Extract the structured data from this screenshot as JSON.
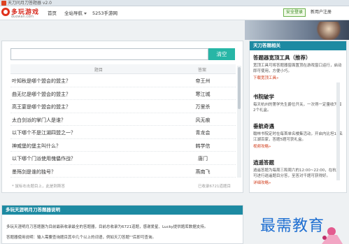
{
  "window": {
    "title": "天刀问月刀答题器 v2.0"
  },
  "nav": {
    "logo_brand": "多玩游戏",
    "logo_domain": "duowan.com",
    "home": "首页",
    "all_nav": "全站导航",
    "mobile": "5253手游网",
    "safe_login": "安全登录",
    "new_user": "新用户注册"
  },
  "search": {
    "button": "清空",
    "placeholder": ""
  },
  "table": {
    "col_question": "题目",
    "col_answer": "答案",
    "rows": [
      {
        "q": "叶知秋是哪个盟会的盟主？",
        "a": "帝王州"
      },
      {
        "q": "曲无忆是哪个盟会的盟主？",
        "a": "寒江城"
      },
      {
        "q": "高王宴是哪个盟会的盟主？",
        "a": "万里杀"
      },
      {
        "q": "太白剑派的掌门人是谁？",
        "a": "风无痕"
      },
      {
        "q": "以下哪个不是江湖四盟之一？",
        "a": "青龙会"
      },
      {
        "q": "神威堡的堡主叫什么？",
        "a": "韩学信"
      },
      {
        "q": "以下哪个门派使用傀儡作战？",
        "a": "唐门"
      },
      {
        "q": "墨殇剑是谁的独号？",
        "a": "燕南飞"
      }
    ],
    "footnote": "* 鼠标右击题目上，此是刺斯答",
    "count": "已收录6721道题目"
  },
  "sidebar": {
    "header": "天刀答题相关",
    "sections": [
      {
        "title": "答题器宽顶工具（推荐）",
        "desc": "宽顶工具可将答题器窗面置顶在游戏窗口运行，启动即可使用，方便小巧。",
        "link": "下载宽顶工具»"
      },
      {
        "title": "书院破学",
        "desc": "每天杭州的第学先生爵位开关，一次得一定量收为和2个礼盒。",
        "link": ""
      },
      {
        "title": "垂航奇遇",
        "desc": "翰林书院定时在每首单名楼集活动，开启内比坦16名江湖百家，答题5题可获礼盒。",
        "link": "视频攻略»"
      },
      {
        "title": "逍遥答题",
        "desc": "逍遥答题为每周三和周六的12:00~22:00，在杭州可进行逍遥题目分答，至答对千题可获得好。",
        "link": "详细攻略»"
      }
    ]
  },
  "bottom": {
    "header": "多玩天涯明月刀答题器说明",
    "line1": "多玩天涯明月刀答题器为目前最新收录最全的答题器，目前总收录为6721道题，感谢爱星、Lucky提供题库数据支持。",
    "line2": "答题器使用说明：输入需要查询题目其中几个以上的词语，例如天刀答题\"\"后即可查询。"
  },
  "watermark": "最需教育",
  "colors": {
    "accent": "#27b6a6",
    "header_teal": "#1d8aa2",
    "brand_red": "#d6281c",
    "link_red": "#d03a18"
  }
}
